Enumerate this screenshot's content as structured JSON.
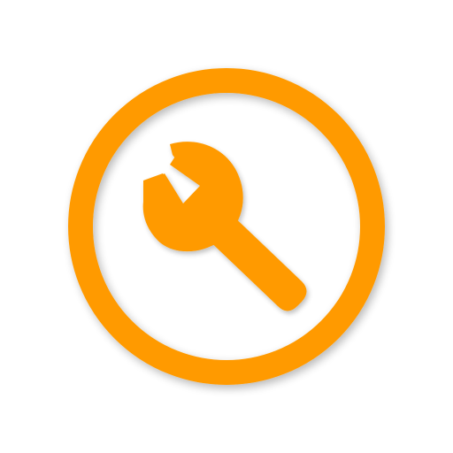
{
  "app_icon": {
    "icon": "wrench-icon",
    "ring_color": "#ff9a00",
    "wrench_color": "#ff9a00",
    "background_color": "#ffffff",
    "shadow_color": "#cfcfcf"
  }
}
